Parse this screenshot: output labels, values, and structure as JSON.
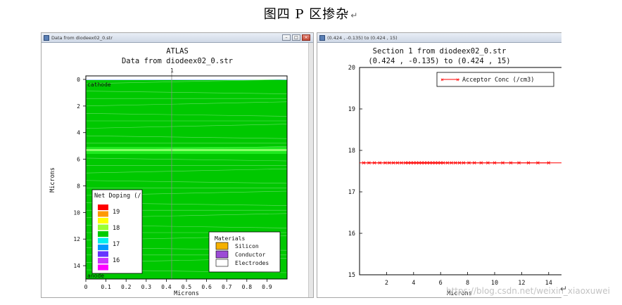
{
  "caption": {
    "text": "图四  P 区掺杂",
    "mark": "↵"
  },
  "left_window": {
    "title": "Data from diodeex02_0.str",
    "plot_title_1": "ATLAS",
    "plot_title_2": "Data from diodeex02_0.str",
    "y_label": "Microns",
    "x_label": "Microns",
    "y_ticks": [
      "0",
      "2",
      "4",
      "6",
      "8",
      "10",
      "12",
      "14"
    ],
    "x_ticks": [
      "0",
      "0.1",
      "0.2",
      "0.3",
      "0.4",
      "0.5",
      "0.6",
      "0.7",
      "0.8",
      "0.9"
    ],
    "electrode_top": "cathode",
    "electrode_bottom": "anode",
    "cutline_label": "1",
    "doping_legend": {
      "title": "Net Doping (/",
      "labels": [
        "19",
        "18",
        "17",
        "16"
      ],
      "colors": [
        "#ff0000",
        "#ff9900",
        "#ffff00",
        "#99ff33",
        "#00cc00",
        "#00eeee",
        "#0099ff",
        "#6633ff",
        "#cc33ff",
        "#ff00ff"
      ]
    },
    "materials_legend": {
      "title": "Materials",
      "items": [
        {
          "name": "Silicon",
          "color": "#f5b000"
        },
        {
          "name": "Conductor",
          "color": "#9c4bd6"
        },
        {
          "name": "Electrodes",
          "color": "#ffffff"
        }
      ]
    }
  },
  "right_window": {
    "title": "(0.424 , -0.135) to (0.424 , 15)",
    "plot_title_1": "Section 1 from diodeex02_0.str",
    "plot_title_2": "(0.424 , -0.135) to (0.424 , 15)",
    "x_label": "Microns",
    "legend": "Acceptor Conc (/cm3)"
  },
  "chart_data": {
    "type": "line",
    "x": [
      0.3,
      0.7,
      1.1,
      1.5,
      1.9,
      2.2,
      2.5,
      2.8,
      3.1,
      3.4,
      3.6,
      3.8,
      4.0,
      4.2,
      4.4,
      4.6,
      4.8,
      5.0,
      5.2,
      5.4,
      5.6,
      5.8,
      6.0,
      6.2,
      6.5,
      6.8,
      7.1,
      7.4,
      7.7,
      8.1,
      8.5,
      9.0,
      9.5,
      10.0,
      10.6,
      11.2,
      11.8,
      12.5,
      13.2,
      14.0
    ],
    "series": [
      {
        "name": "Acceptor Conc (/cm3)",
        "values": [
          17.7,
          17.7,
          17.7,
          17.7,
          17.7,
          17.7,
          17.7,
          17.7,
          17.7,
          17.7,
          17.7,
          17.7,
          17.7,
          17.7,
          17.7,
          17.7,
          17.7,
          17.7,
          17.7,
          17.7,
          17.7,
          17.7,
          17.7,
          17.7,
          17.7,
          17.7,
          17.7,
          17.7,
          17.7,
          17.7,
          17.7,
          17.7,
          17.7,
          17.7,
          17.7,
          17.7,
          17.7,
          17.7,
          17.7,
          17.7
        ],
        "color": "#ff0000"
      }
    ],
    "xlabel": "Microns",
    "ylabel": "",
    "xlim": [
      0,
      15
    ],
    "ylim": [
      15,
      20
    ],
    "x_ticks": [
      2,
      4,
      6,
      8,
      10,
      12,
      14
    ],
    "y_ticks": [
      15,
      16,
      17,
      18,
      19,
      20
    ],
    "grid": false,
    "legend": "top-right"
  },
  "watermark": "https://blog.csdn.net/weixin_xiaoxuwei"
}
